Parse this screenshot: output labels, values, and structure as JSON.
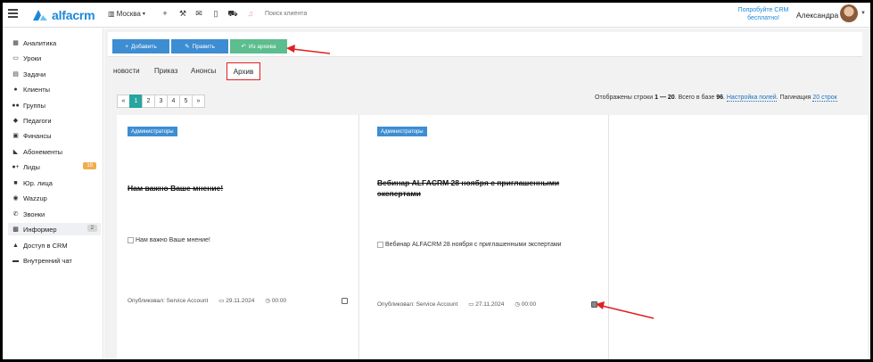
{
  "app": {
    "logo_text": "alfacrm"
  },
  "topbar": {
    "city": "Москва",
    "search_placeholder": "Поиск клиента",
    "promo": "Попробуйте CRM бесплатно!",
    "user_name": "Александра"
  },
  "sidebar": {
    "items": [
      {
        "label": "Аналитика",
        "icon": "chart-icon"
      },
      {
        "label": "Уроки",
        "icon": "calendar-icon"
      },
      {
        "label": "Задачи",
        "icon": "tasks-icon"
      },
      {
        "label": "Клиенты",
        "icon": "user-icon"
      },
      {
        "label": "Группы",
        "icon": "group-icon"
      },
      {
        "label": "Педагоги",
        "icon": "graduation-icon"
      },
      {
        "label": "Финансы",
        "icon": "money-icon"
      },
      {
        "label": "Абонементы",
        "icon": "tag-icon"
      },
      {
        "label": "Лиды",
        "icon": "user-plus-icon",
        "badge": "19"
      },
      {
        "label": "Юр. лица",
        "icon": "briefcase-icon"
      },
      {
        "label": "Wazzup",
        "icon": "chat-icon"
      },
      {
        "label": "Звонки",
        "icon": "phone-icon"
      },
      {
        "label": "Информер",
        "icon": "informer-icon",
        "badge": "2",
        "active": true
      },
      {
        "label": "Доступ в CRM",
        "icon": "lock-icon"
      },
      {
        "label": "Внутренний чат",
        "icon": "message-icon"
      }
    ]
  },
  "toolbar": {
    "add_label": "Добавить",
    "edit_label": "Править",
    "archive_label": "Из архива"
  },
  "tabs": {
    "items": [
      "новости",
      "Приказ",
      "Анонсы"
    ],
    "active": "Архив"
  },
  "pager": {
    "prev": "«",
    "pages": [
      "1",
      "2",
      "3",
      "4",
      "5"
    ],
    "next": "»",
    "current": "1"
  },
  "rows_info": {
    "prefix": "Отображены строки",
    "range": "1 — 20",
    "total_text": ". Всего в базе",
    "total": "96",
    "settings_link": "Настройка полей",
    "pagination_label": ". Пагинация",
    "pagination_link": "20 строк"
  },
  "cards": [
    {
      "tag": "Администраторы",
      "title": "Нам важно Ваше мнение!",
      "image_alt": "Нам важно Ваше мнение!",
      "author": "Опубликовал: Service Account",
      "date": "29.11.2024",
      "time": "00:00",
      "checked": false
    },
    {
      "tag": "Администраторы",
      "title": "Вебинар ALFACRM 28 ноября с приглашенными экспертами",
      "image_alt": "Вебинар ALFACRM 28 ноября с приглашенными экспертами",
      "author": "Опубликовал: Service Account",
      "date": "27.11.2024",
      "time": "00:00",
      "checked": true
    }
  ],
  "colors": {
    "brand": "#1e88d8",
    "primary_button": "#3d8dd2",
    "archive_button": "#5cbd8f",
    "active_page": "#27a59f",
    "annotation": "#e02020",
    "lids_badge": "#f0ad4e"
  }
}
